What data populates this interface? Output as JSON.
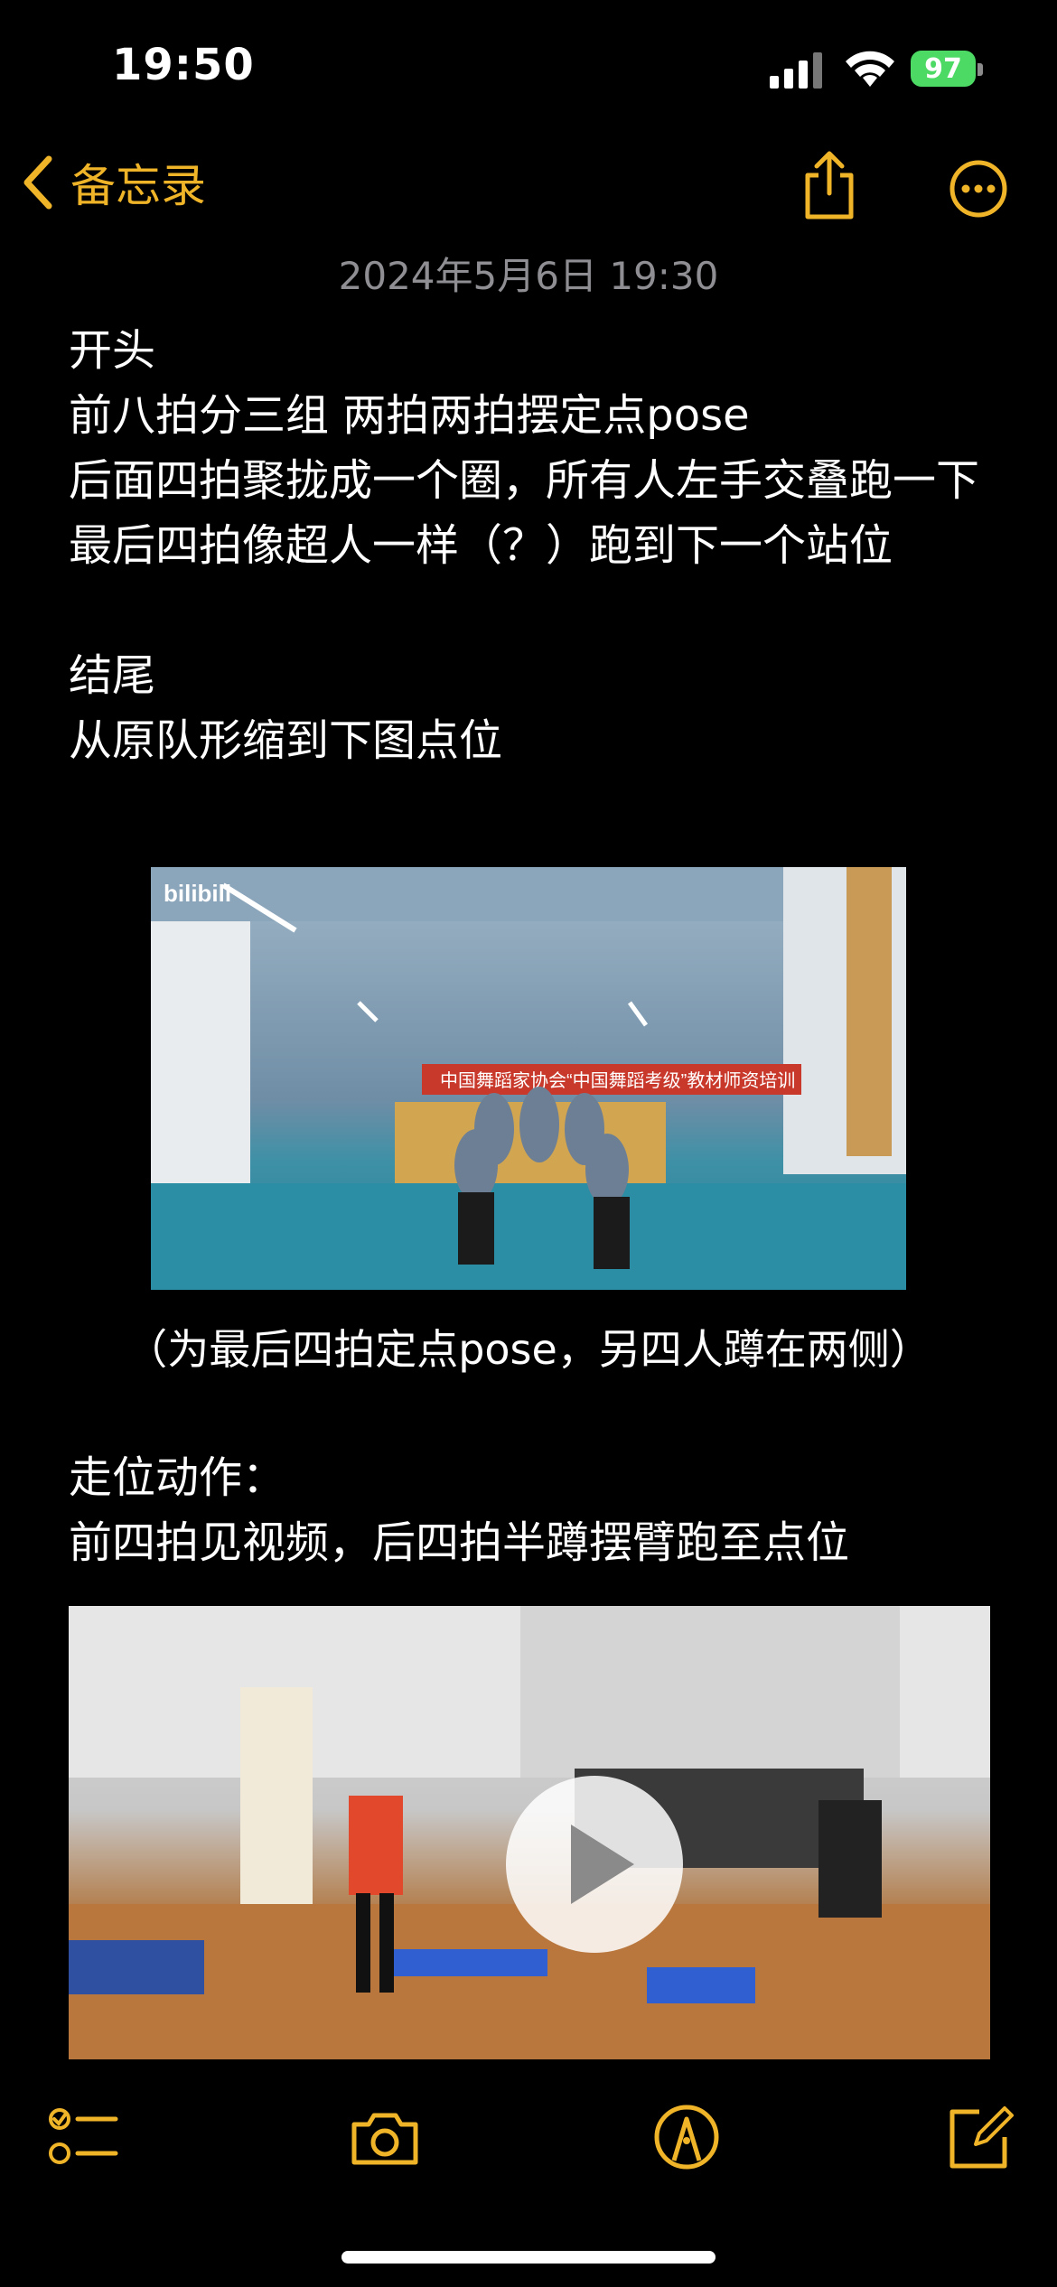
{
  "status_bar": {
    "time": "19:50",
    "battery": "97"
  },
  "nav": {
    "back_label": "备忘录"
  },
  "note": {
    "date": "2024年5月6日 19:30",
    "lines_top": [
      "开头",
      "前八拍分三组 两拍两拍摆定点pose",
      "后面四拍聚拢成一个圈，所有人左手交叠跑一下",
      "最后四拍像超人一样（？）跑到下一个站位",
      "",
      "结尾",
      "从原队形缩到下图点位"
    ],
    "image_caption": "（为最后四拍定点pose，另四人蹲在两侧）",
    "lines_bottom": [
      "走位动作：",
      "前四拍见视频，后四拍半蹲摆臂跑至点位"
    ],
    "image_overlay_text": "bilibili",
    "banner_text": "中国舞蹈家协会“中国舞蹈考级”教材师资培训"
  },
  "colors": {
    "accent": "#f0b429",
    "background": "#000000",
    "battery": "#4cd964"
  },
  "toolbar": {
    "icons": [
      "checklist-icon",
      "camera-icon",
      "markup-icon",
      "compose-icon"
    ]
  }
}
